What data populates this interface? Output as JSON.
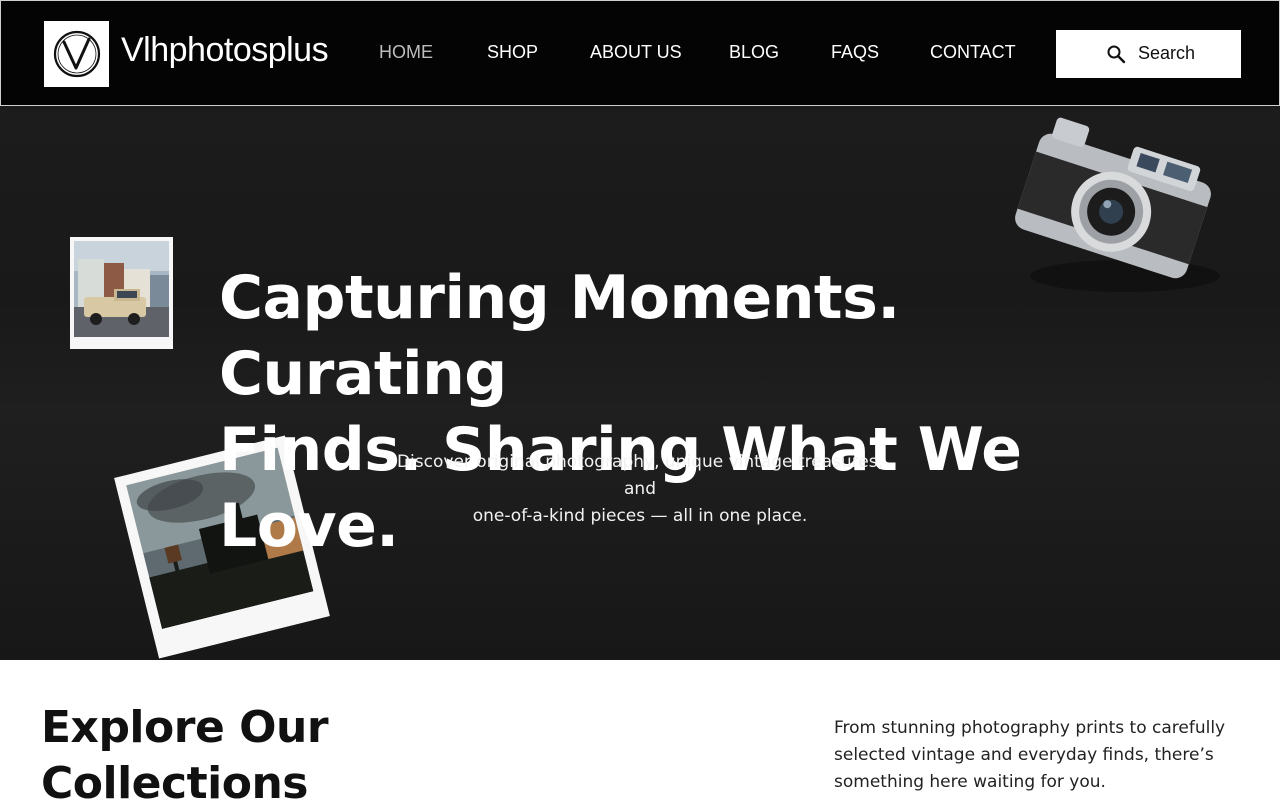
{
  "header": {
    "brand": "Vlhphotosplus",
    "nav": [
      {
        "label": "HOME",
        "active": true
      },
      {
        "label": "SHOP",
        "active": false
      },
      {
        "label": "ABOUT US",
        "active": false
      },
      {
        "label": "BLOG",
        "active": false
      },
      {
        "label": "FAQS",
        "active": false
      },
      {
        "label": "CONTACT",
        "active": false
      }
    ],
    "search_label": "Search",
    "logo_icon": "v-monogram-logo",
    "search_icon": "magnifier-icon"
  },
  "hero": {
    "headline_line1": "Capturing Moments. Curating",
    "headline_line2": "Finds. Sharing What We Love.",
    "subtitle_line1": "Discover original photography, unique vintage treasures, and",
    "subtitle_line2": "one-of-a-kind pieces — all in one place."
  },
  "collections": {
    "title_line1": "Explore Our",
    "title_line2": "Collections",
    "description": "From stunning photography prints to carefully selected vintage and everyday finds, there’s something here waiting for you."
  },
  "colors": {
    "header_bg": "#040404",
    "hero_bg": "#1b1b1b",
    "nav_active": "#bdbdbd",
    "text_light": "#ffffff",
    "text_dark": "#111111"
  }
}
